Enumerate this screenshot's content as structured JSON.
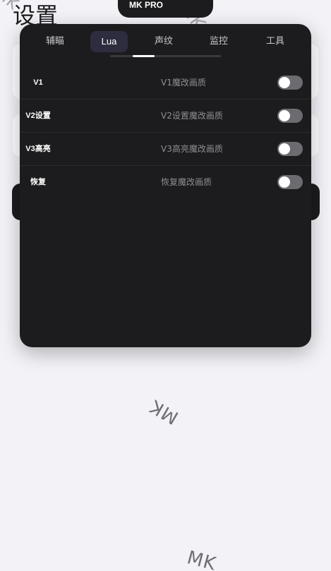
{
  "background": {
    "title": "设置",
    "watermark": "MK"
  },
  "header": {
    "badge": "MK PRO"
  },
  "tabs": [
    {
      "label": "辅瞄",
      "selected": false
    },
    {
      "label": "Lua",
      "selected": true
    },
    {
      "label": "声纹",
      "selected": false
    },
    {
      "label": "监控",
      "selected": false
    },
    {
      "label": "工具",
      "selected": false
    }
  ],
  "rows": [
    {
      "label": "V1",
      "description": "V1魔改画质",
      "enabled": false
    },
    {
      "label": "V2设置",
      "description": "V2设置魔改画质",
      "enabled": false
    },
    {
      "label": "V3高亮",
      "description": "V3高亮魔改画质",
      "enabled": false
    },
    {
      "label": "恢复",
      "description": "恢复魔改画质",
      "enabled": false
    }
  ],
  "colors": {
    "panel_bg": "#1c1c1e",
    "selected_tab_bg": "#2e2d3f",
    "toggle_off": "#6b6b70",
    "page_bg": "#f2f2f7"
  }
}
